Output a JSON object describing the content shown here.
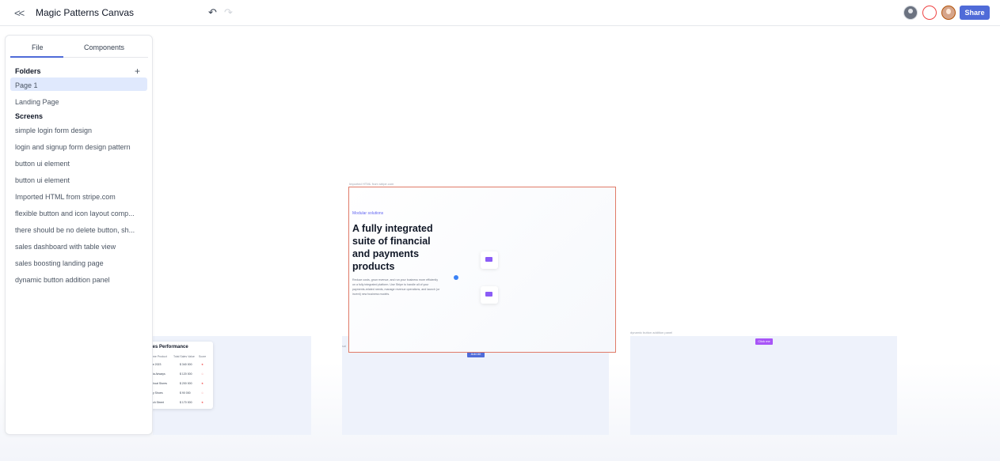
{
  "topbar": {
    "back_icon": "double-chevron-left-icon",
    "title": "Magic Patterns Canvas",
    "undo_icon": "undo-icon",
    "redo_icon": "redo-icon",
    "share_label": "Share"
  },
  "sidebar": {
    "tabs": [
      {
        "label": "File",
        "active": true
      },
      {
        "label": "Components",
        "active": false
      }
    ],
    "folders_heading": "Folders",
    "add_icon": "plus-icon",
    "folders": [
      {
        "label": "Page 1",
        "active": true
      },
      {
        "label": "Landing Page",
        "active": false
      }
    ],
    "screens_heading": "Screens",
    "screens": [
      "simple login form design",
      "login and signup form design pattern",
      "button ui element",
      "button ui element",
      "Imported HTML from stripe.com",
      "flexible button and icon layout comp...",
      "there should be no delete button, sh...",
      "sales dashboard with table view",
      "sales boosting landing page",
      "dynamic button addition panel"
    ]
  },
  "canvas": {
    "main_frame": {
      "label": "Imported HTML from stripe.com",
      "eyebrow": "Modular solutions",
      "headline": "A fully integrated suite of financial and payments products",
      "body": "Reduce costs, grow revenue, and run your business more efficiently on a fully integrated platform. Use Stripe to handle all of your payments-related needs, manage revenue operations, and launch (or invent) new business models."
    },
    "table_card": {
      "title": "les Performance",
      "headers": [
        "ame Product",
        "Total Sales Value",
        "Score"
      ],
      "rows": [
        [
          "ve 2023",
          "$ 340 000",
          "★"
        ],
        [
          "dia Airways",
          "$ 120 000",
          "☆"
        ],
        [
          "Shoal Stores",
          "$ 200 000",
          "★"
        ],
        [
          "dy Shoes",
          "$ 90 000",
          "☆"
        ],
        [
          "ach Street",
          "$ 170 000",
          "★"
        ]
      ]
    },
    "frame_labels": {
      "left_small": "sal",
      "right": "dynamic button addition panel"
    },
    "tags": {
      "blue": "Add Alt",
      "purple": "Click me"
    },
    "colors": {
      "accent": "#4f6bd8",
      "selection": "#e07b68",
      "purple": "#8b5cf6"
    }
  }
}
